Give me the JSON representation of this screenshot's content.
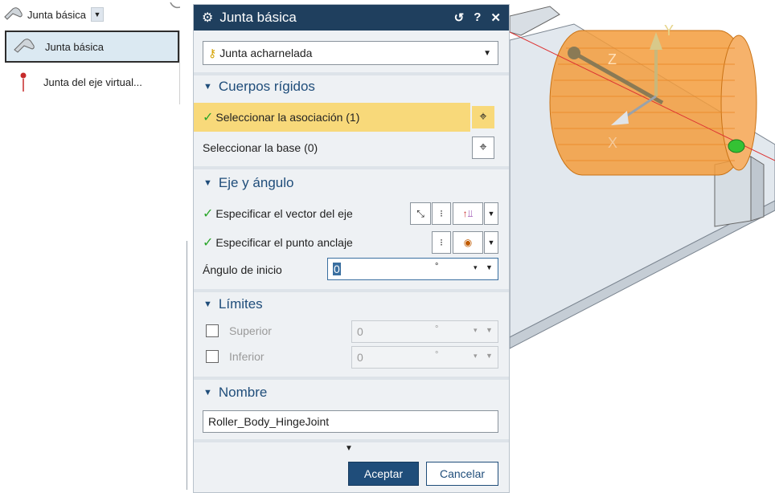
{
  "ribbon": {
    "button_label": "Junta básica"
  },
  "menu": {
    "items": [
      {
        "label": "Junta básica"
      },
      {
        "label": "Junta del eje virtual..."
      }
    ]
  },
  "dialog": {
    "title": "Junta básica",
    "type_value": "Junta acharnelada",
    "sections": {
      "rigid": {
        "title": "Cuerpos rígidos",
        "select_association": "Seleccionar la asociación (1)",
        "select_base": "Seleccionar la base (0)"
      },
      "axis": {
        "title": "Eje y ángulo",
        "vector_label": "Especificar el vector del eje",
        "anchor_label": "Especificar el punto anclaje",
        "start_angle_label": "Ángulo de inicio",
        "start_angle_value": "0",
        "unit": "°"
      },
      "limits": {
        "title": "Límites",
        "upper_label": "Superior",
        "upper_value": "0",
        "lower_label": "Inferior",
        "lower_value": "0",
        "unit": "°"
      },
      "name": {
        "title": "Nombre",
        "value": "Roller_Body_HingeJoint"
      }
    },
    "ok_label": "Aceptar",
    "cancel_label": "Cancelar"
  },
  "viewport": {
    "axis_labels": {
      "y": "Y",
      "z": "Z",
      "x": "X"
    }
  },
  "colors": {
    "titlebar": "#1f3f5e",
    "accent": "#1f4d7a",
    "selection": "#f8d97a",
    "roller": "#f39c3c"
  }
}
